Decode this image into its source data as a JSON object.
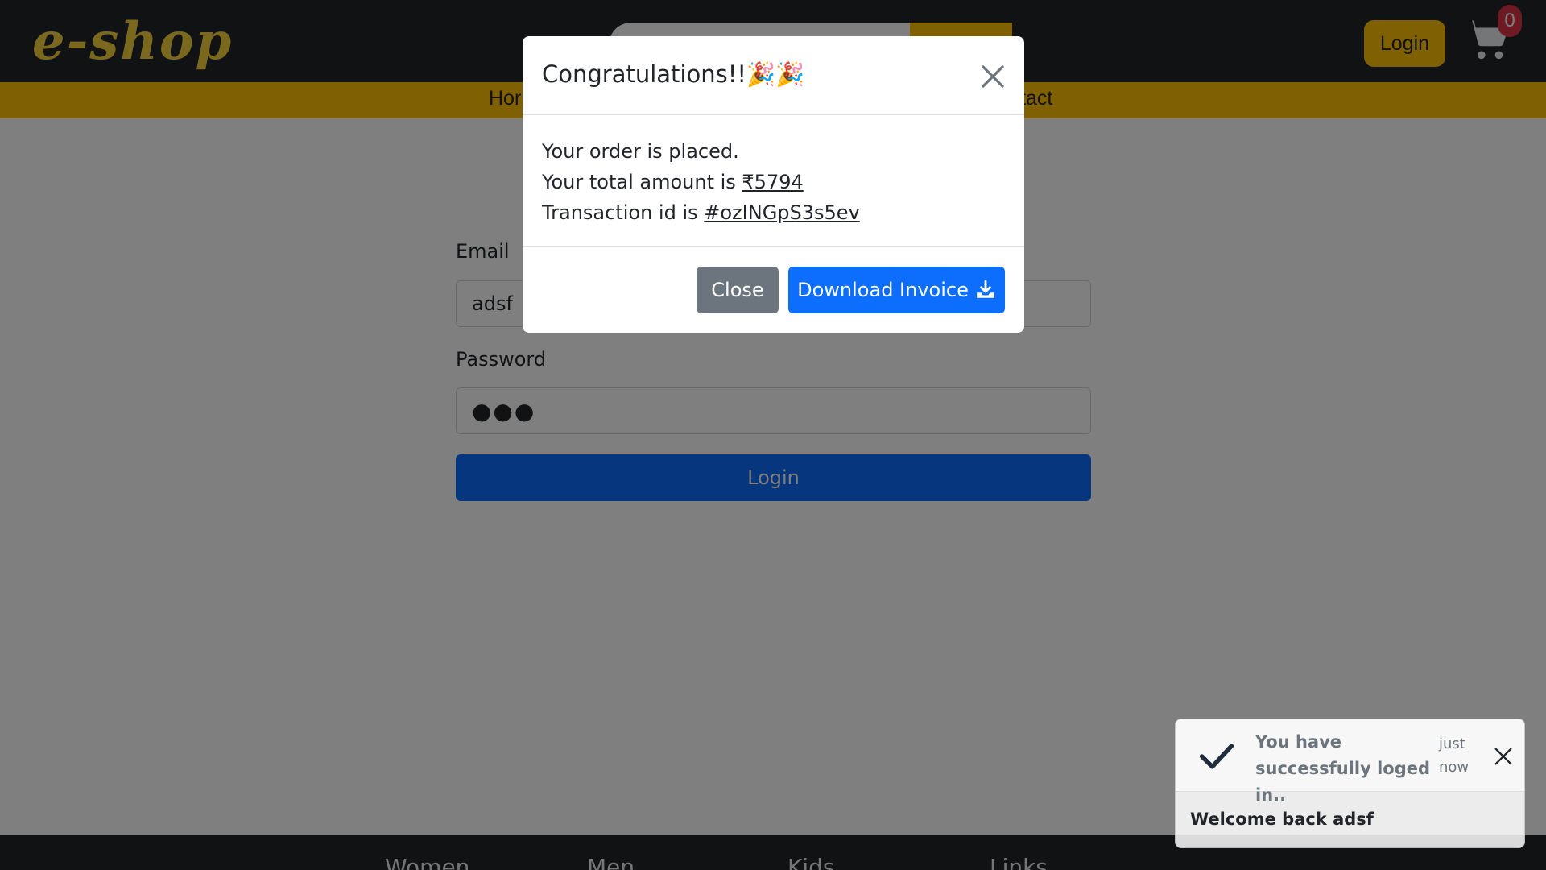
{
  "navbar": {
    "logo": "e-shop",
    "login_label": "Login",
    "cart_count": "0"
  },
  "subnav": {
    "left_fragment": "Hor",
    "right_fragment": "tact"
  },
  "login_form": {
    "email_label": "Email",
    "email_value": "adsf",
    "password_label": "Password",
    "password_value": "●●●",
    "submit_label": "Login"
  },
  "footer": {
    "columns": [
      "Women",
      "Men",
      "Kids",
      "Links"
    ]
  },
  "modal": {
    "title": "Congratulations!!🎉🎉",
    "line1": "Your order is placed.",
    "line2_prefix": "Your total amount is ",
    "amount": "₹5794",
    "line3_prefix": "Transaction id is ",
    "transaction_id": "#ozINGpS3s5ev",
    "close_label": "Close",
    "download_label": "Download Invoice"
  },
  "toast": {
    "title": "You have successfully loged in..",
    "time": "just now",
    "body": "Welcome back adsf"
  },
  "icons": {
    "cart": "cart-icon",
    "close": "close-icon",
    "download": "download-icon",
    "check": "check-icon"
  },
  "colors": {
    "navbar": "#212529",
    "accent": "#ffc107",
    "primary": "#0d6efd",
    "secondary": "#6c757d",
    "badge": "#dc3545"
  }
}
